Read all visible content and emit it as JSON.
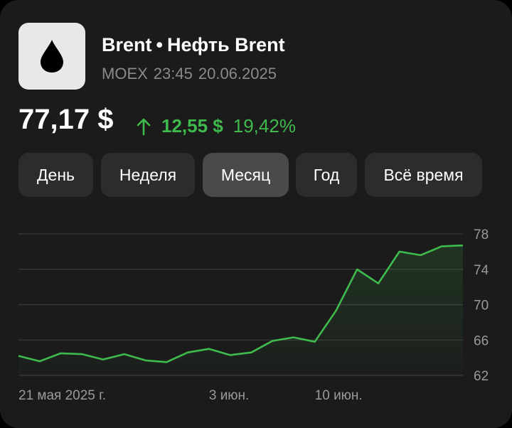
{
  "header": {
    "ticker": "Brent",
    "separator": "•",
    "name": "Нефть Brent",
    "exchange": "MOEX",
    "time": "23:45",
    "date": "20.06.2025",
    "icon": "oil-drop-icon"
  },
  "quote": {
    "price": "77,17 $",
    "change_abs": "12,55 $",
    "change_pct": "19,42%",
    "direction_icon": "arrow-up-icon",
    "color_up": "#3fbb4e"
  },
  "tabs": [
    {
      "label": "День",
      "active": false
    },
    {
      "label": "Неделя",
      "active": false
    },
    {
      "label": "Месяц",
      "active": true
    },
    {
      "label": "Год",
      "active": false
    },
    {
      "label": "Всё время",
      "active": false
    }
  ],
  "chart_data": {
    "type": "area",
    "title": "",
    "xlabel": "",
    "ylabel": "",
    "grid": true,
    "ylim": [
      62,
      78
    ],
    "yticks": [
      62,
      66,
      70,
      74,
      78
    ],
    "y_axis_position": "right",
    "x_tick_labels": [
      "21 мая 2025 г.",
      "3 июн.",
      "10 июн."
    ],
    "x_tick_indices": [
      0,
      9,
      14
    ],
    "series": [
      {
        "color": "#3fbb4e",
        "values": [
          64.2,
          63.6,
          64.5,
          64.4,
          63.8,
          64.4,
          63.7,
          63.5,
          64.6,
          65.0,
          64.3,
          64.6,
          65.9,
          66.3,
          65.8,
          69.3,
          74.0,
          72.4,
          76.0,
          75.6,
          76.6,
          76.7
        ]
      }
    ]
  }
}
